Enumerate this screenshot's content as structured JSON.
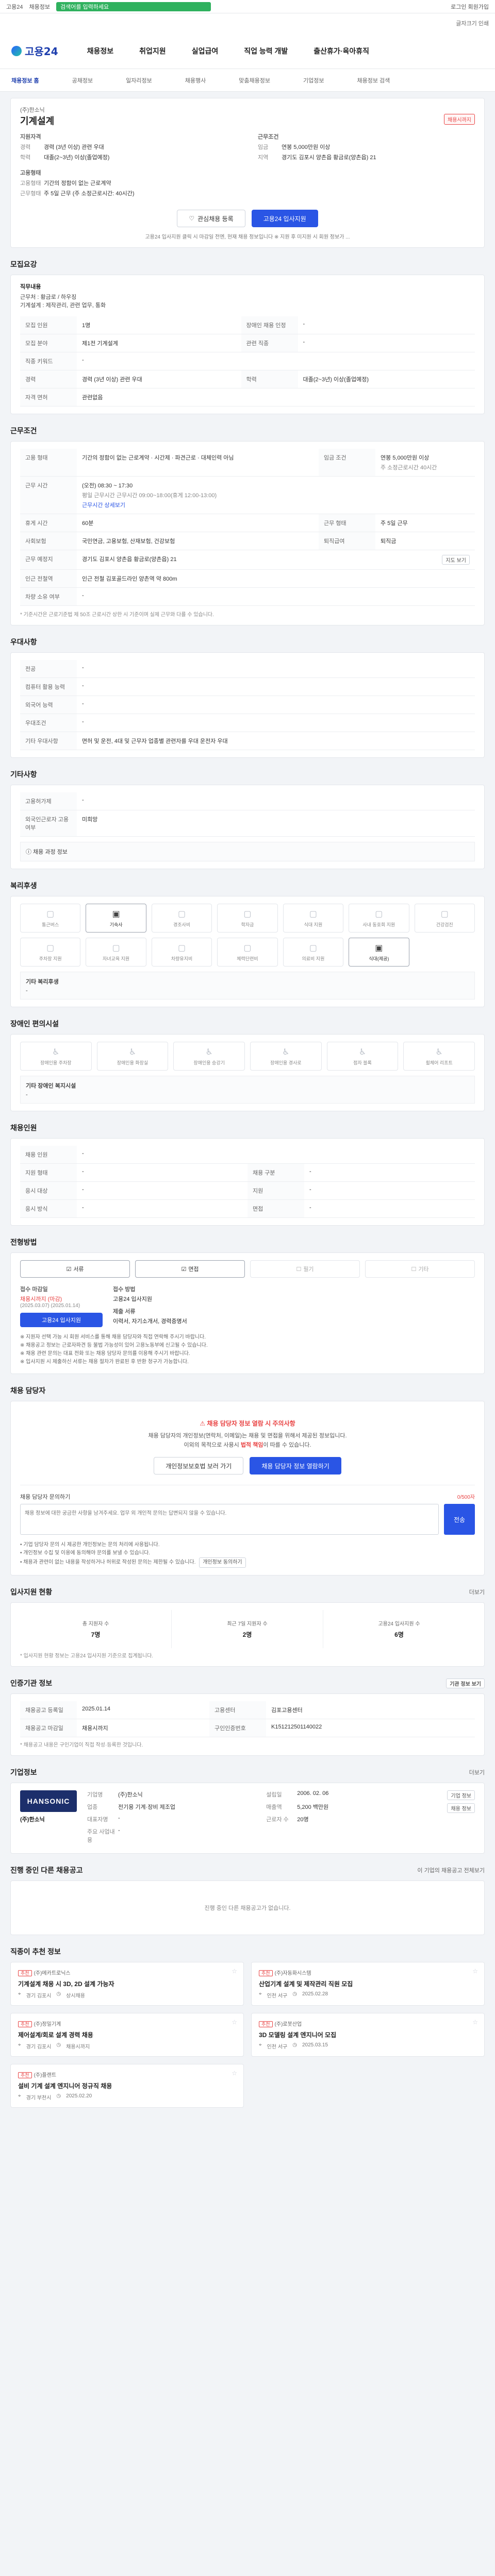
{
  "topbar": {
    "brand": "고용24",
    "links": "채용정보",
    "search_placeholder": "검색어를 입력하세요",
    "right_links": "로그인 회원가입"
  },
  "subtopbar": {
    "items": "글자크기 인쇄"
  },
  "header": {
    "logo": "고용24",
    "gnb": [
      "채용정보",
      "취업지원",
      "실업급여",
      "직업 능력 개발",
      "출산휴가·육아휴직"
    ]
  },
  "lnb": {
    "items": [
      "채용정보 홈",
      "공채정보",
      "일자리정보",
      "채용행사",
      "맞춤채용정보",
      "기업정보",
      "채용정보 검색"
    ]
  },
  "job": {
    "company_name": "(주)한소닉",
    "title": "기계설계",
    "badge": "채용시까지",
    "req_label": "지원자격",
    "req_kv": [
      [
        "경력",
        "경력 (3년 이상) 관련 우대"
      ],
      [
        "학력",
        "대졸(2~3년) 이상(졸업예정)"
      ]
    ],
    "cond_label": "근무조건",
    "cond_kv": [
      [
        "임금",
        "연봉 5,000만원 이상"
      ],
      [
        "지역",
        "경기도 김포시 양촌읍 황금로(양촌읍) 21"
      ]
    ],
    "emp_label": "고용형태",
    "emp_kv": [
      [
        "고용형태",
        "기간의 정함이 없는 근로계약"
      ],
      [
        "근무형태",
        "주 5일 근무 (주 소정근로시간: 40시간)"
      ]
    ],
    "scrap_label": "관심채용 등록",
    "apply_label": "고용24 입사지원",
    "note": "고용24 입사지원 클릭 시 마감일 전엔, 현재 채용 정보입니다 ※ 지원 후 미지원 시 회원 정보가 ..."
  },
  "recruit": {
    "title": "모집요강",
    "duty_label": "직무내용",
    "duty_text": "근무처 : 황금로 / 하우징\n기계설계 : 제작관리, 관련 업무, 통화",
    "rows": [
      {
        "k": "모집 인원",
        "v": "1명",
        "k2": "장애인 채용 인정",
        "v2": "-"
      },
      {
        "k": "모집 분야",
        "v": "제1전 기계설계",
        "k2": "관련 직종",
        "v2": "-"
      },
      {
        "k": "직종 키워드",
        "v": "-",
        "k2": "",
        "v2": ""
      },
      {
        "k": "경력",
        "v": "경력 (3년 이상) 관련 우대",
        "k2": "학력",
        "v2": "대졸(2~3년) 이상(졸업예정)"
      },
      {
        "k": "자격 면허",
        "v": "관련없음",
        "k2": "",
        "v2": ""
      }
    ]
  },
  "work": {
    "title": "근무조건",
    "employ_type_k": "고용 형태",
    "employ_type_v": "기간의 정함이 없는 근로계약 · 시간제 · 파견근로 · 대체인력 아님",
    "wage_k": "임금 조건",
    "wage_v": "연봉 5,000만원 이상",
    "wage_sub": "주 소정근로시간 40시간",
    "hours_k": "근무 시간",
    "hours_v": "(오전) 08:30 ~ 17:30",
    "hours_sub": "평일 근무시간 근무시간 09:00~18:00(휴게 12:00-13:00)",
    "hours_link": "근무시간 상세보기",
    "days_k": "휴게 시간",
    "days_v": "60분",
    "week_k": "근무 형태",
    "week_v": "주 5일 근무",
    "ins_k": "사회보험",
    "ins_v": "국민연금, 고용보험, 산재보험, 건강보험",
    "retire_k": "퇴직급여",
    "retire_v": "퇴직금",
    "loc_k": "근무 예정지",
    "loc_v": "경기도 김포시 양촌읍 황금로(양촌읍) 21",
    "loc_btn": "지도 보기",
    "station_k": "인근 전철역",
    "station_v": "인근 전철 김포골드라인 양촌역 약 800m",
    "car_k": "차량 소유 여부",
    "car_v": "-",
    "footnote": "* 기준시간은 근로기준법 제 50조 근로시간 상한 시 기준이며 실제 근무와 다를 수 있습니다."
  },
  "pref": {
    "title": "우대사항",
    "rows": [
      {
        "k": "전공",
        "v": "-"
      },
      {
        "k": "컴퓨터 활용 능력",
        "v": "-"
      },
      {
        "k": "외국어 능력",
        "v": "-"
      },
      {
        "k": "우대조건",
        "v": "-"
      },
      {
        "k": "기타 우대사항",
        "v": "면허 및 운전, 4대 및 근무자 업종별 관련자를 우대 운전자 우대"
      }
    ]
  },
  "process": {
    "title": "기타사항",
    "rows": [
      {
        "k": "고용허가제",
        "v": "-"
      },
      {
        "k": "외국인근로자 고용 여부",
        "v": "미희망"
      }
    ],
    "pre_label": "채용 과정 정보"
  },
  "welfare": {
    "title": "복리후생",
    "items": [
      {
        "name": "통근버스",
        "on": false
      },
      {
        "name": "기숙사",
        "on": true
      },
      {
        "name": "경조사비",
        "on": false
      },
      {
        "name": "학자금",
        "on": false
      },
      {
        "name": "식대 지원",
        "on": false
      },
      {
        "name": "사내 동호회 지원",
        "on": false
      },
      {
        "name": "건강검진",
        "on": false
      },
      {
        "name": "주차장 지원",
        "on": false
      },
      {
        "name": "자녀교육 지원",
        "on": false
      },
      {
        "name": "차량유지비",
        "on": false
      },
      {
        "name": "체력단련비",
        "on": false
      },
      {
        "name": "의료비 지원",
        "on": false
      },
      {
        "name": "식대(제공)",
        "on": true
      }
    ],
    "extra_label": "기타 복리후생",
    "extra_value": "-"
  },
  "facility": {
    "title": "장애인 편의시설",
    "items": [
      {
        "name": "장애인용 주차장",
        "on": false
      },
      {
        "name": "장애인용 화장실",
        "on": false
      },
      {
        "name": "장애인용 승강기",
        "on": false
      },
      {
        "name": "장애인용 경사로",
        "on": false
      },
      {
        "name": "점자 블록",
        "on": false
      },
      {
        "name": "휠체어 리프트",
        "on": false
      }
    ],
    "extra_label": "기타 장애인 복지시설",
    "extra_value": "-"
  },
  "assist": {
    "title": "채용인원",
    "rows": [
      {
        "k": "채용 인원",
        "v": "-",
        "k2": "",
        "v2": ""
      },
      {
        "k": "지원 형태",
        "v": "-",
        "k2": "채용 구분",
        "v2": "-"
      },
      {
        "k": "응시 대상",
        "v": "-",
        "k2": "지원",
        "v2": "-"
      },
      {
        "k": "응시 방식",
        "v": "-",
        "k2": "면접",
        "v2": "-"
      }
    ]
  },
  "method": {
    "title": "전형방법",
    "items": [
      {
        "name": "서류",
        "on": true
      },
      {
        "name": "면접",
        "on": true
      },
      {
        "name": "필기",
        "on": false
      },
      {
        "name": "기타",
        "on": false
      }
    ],
    "deadline_label": "접수 마감일",
    "deadline_value": "채용시까지 (마감)",
    "deadline_sub": "(2025.03.07) (2025.01.14)",
    "apply_btn": "고용24 입사지원",
    "doc_label": "접수 방법",
    "doc_value": "고용24 입사지원",
    "file_label": "제출 서류",
    "file_value": "이력서, 자기소개서, 경력증명서",
    "notes": [
      "※ 지원자 선택 가능 시 회원 서비스를 통해 채용 담당자와 직접 연락해 주시기 바랍니다.",
      "※ 채용공고 정보는 근로자파견 등 불법 가능성이 있어 고용노동부에 신고될 수 있습니다.",
      "※ 채용 관련 문의는 대표 전화 또는 채용 담당자 문의를 이용해 주시기 바랍니다.",
      "※ 입사지원 시 제출하신 서류는 채용 절차가 완료된 후 반환 청구가 가능합니다."
    ]
  },
  "contact": {
    "title": "채용 담당자",
    "alert_title": "채용 담당자 정보 열람 시 주의사항",
    "alert_text1": "채용 담당자의 개인정보(연락처, 이메일)는 채용 및 면접을 위해서 제공된 정보입니다.",
    "alert_text2": "이외의 목적으로 사용시 ",
    "alert_red": "법적 책임",
    "alert_text3": "이 따를 수 있습니다.",
    "btn_back": "개인정보보호법 보러 가기",
    "btn_view": "채용 담당자 정보 열람하기",
    "inquiry_label": "채용 담당자 문의하기",
    "inquiry_count": "0/500자",
    "inquiry_placeholder": "채용 정보에 대한 궁금한 사항을 남겨주세요. 업무 외 개인적 문의는 답변되지 않을 수 있습니다.",
    "inquiry_submit": "전송",
    "notes": [
      "• 기업 담당자 문의 시 제공한 개인정보는 문의 처리에 사용됩니다.",
      "• 개인정보 수집 및 이용에 동의해야 문의를 보낼 수 있습니다.",
      "• 채용과 관련이 없는 내용을 작성하거나 허위로 작성된 문의는 제한될 수 있습니다."
    ],
    "notes_btn": "개인정보 동의하기"
  },
  "stats": {
    "title": "입사지원 현황",
    "more": "더보기",
    "items": [
      {
        "label": "총 지원자 수",
        "value": "7명"
      },
      {
        "label": "최근 7일 지원자 수",
        "value": "2명"
      },
      {
        "label": "고용24 입사지원 수",
        "value": "6명"
      }
    ],
    "footnote": "* 입사지원 현황 정보는 고용24 입사지원 기준으로 집계됩니다."
  },
  "org": {
    "title": "인증기관 정보",
    "btn": "기관 정보 보기",
    "rows": [
      {
        "k": "채용공고 등록일",
        "v": "2025.01.14",
        "k2": "고용센터",
        "v2": "김포고용센터"
      },
      {
        "k": "채용공고 마감일",
        "v": "채용시까지",
        "k2": "구인인증번호",
        "v2": "K151212501140022"
      }
    ],
    "note": "* 채용공고 내용은 구인기업이 직접 작성·등록한 것입니다."
  },
  "company": {
    "title": "기업정보",
    "more": "더보기",
    "logo": "HANSONIC",
    "name": "(주)한소닉",
    "rows": [
      {
        "k": "기업명",
        "v": "(주)한소닉"
      },
      {
        "k": "업종",
        "v": "전기용 기계·장비 제조업"
      },
      {
        "k": "대표자명",
        "v": "-"
      },
      {
        "k": "주요 사업내용",
        "v": "-"
      },
      {
        "k": "설립일",
        "v": "2006. 02. 06"
      },
      {
        "k": "매출액",
        "v": "5,200 백만원"
      },
      {
        "k": "근로자 수",
        "v": "20명"
      }
    ],
    "btn1": "기업 정보",
    "btn2": "채용 정보"
  },
  "ongoing": {
    "title": "진행 중인 다른 채용공고",
    "more": "이 기업의 채용공고 전체보기",
    "empty": "진행 중인 다른 채용공고가 없습니다."
  },
  "recommend": {
    "title": "직종이 추천 정보",
    "cards": [
      {
        "tag": "추천",
        "corp": "(주)메카트로닉스",
        "title": "기계설계 채용 시 3D, 2D 설계 가능자",
        "loc": "경기 김포시",
        "period": "상시채용"
      },
      {
        "tag": "추천",
        "corp": "(주)자동화시스템",
        "title": "산업기계 설계 및 제작관리 직원 모집",
        "loc": "인천 서구",
        "period": "2025.02.28"
      },
      {
        "tag": "추천",
        "corp": "(주)정밀기계",
        "title": "제어설계/회로 설계 경력 채용",
        "loc": "경기 김포시",
        "period": "채용시까지"
      },
      {
        "tag": "추천",
        "corp": "(주)로봇산업",
        "title": "3D 모델링 설계 엔지니어 모집",
        "loc": "인천 서구",
        "period": "2025.03.15"
      },
      {
        "tag": "추천",
        "corp": "(주)플랜트",
        "title": "설비 기계 설계 엔지니어 정규직 채용",
        "loc": "경기 부천시",
        "period": "2025.02.20"
      }
    ]
  }
}
